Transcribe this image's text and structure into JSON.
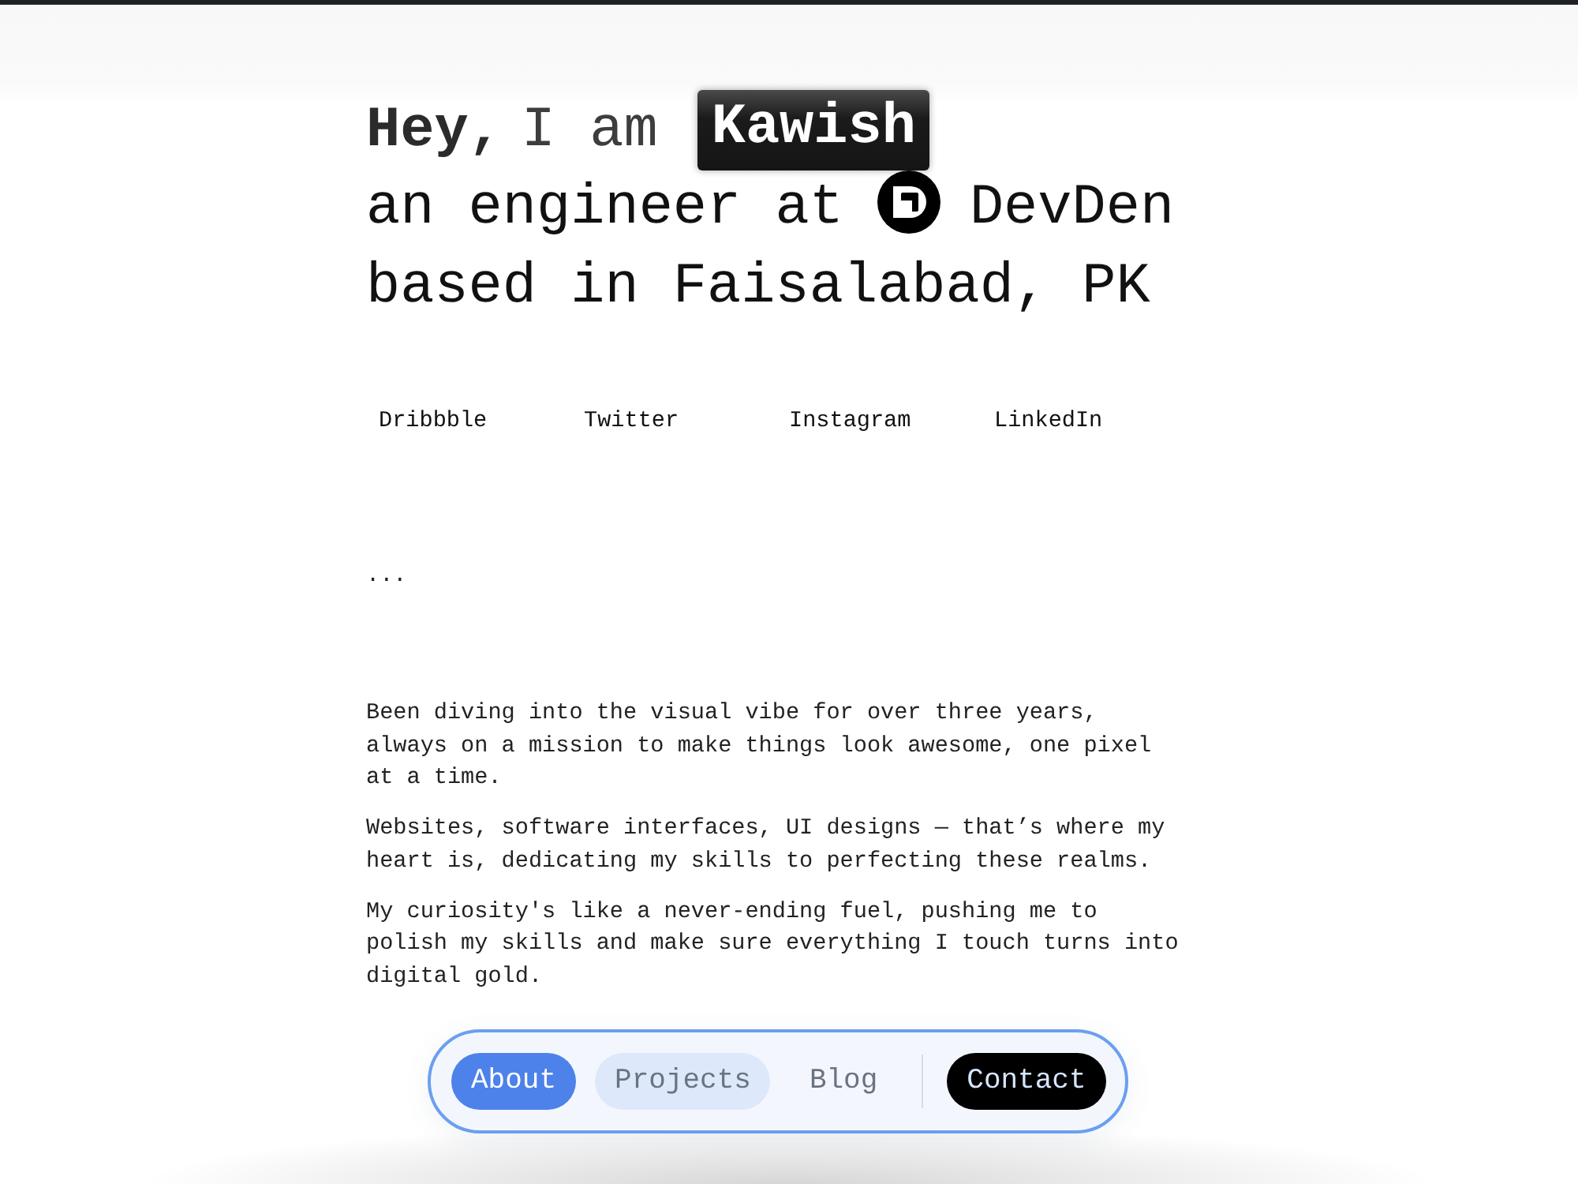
{
  "hero": {
    "greeting": "Hey,",
    "intro": "I am",
    "name": "Kawish",
    "role_line": "an engineer at",
    "company": "DevDen",
    "location_line": "based in Faisalabad, PK"
  },
  "social_links": [
    "Dribbble",
    "Twitter",
    "Instagram",
    "LinkedIn"
  ],
  "ellipsis": "...",
  "about_paragraphs": [
    "Been diving into the visual vibe for over three years, always on a mission to make things look awesome, one pixel at a time.",
    "Websites, software interfaces, UI designs — that’s where my heart is, dedicating my skills to perfecting these realms.",
    "My curiosity's like a never-ending fuel, pushing me to polish my skills and make sure everything I touch turns into digital gold."
  ],
  "nav": {
    "items": [
      {
        "label": "About",
        "selected": true,
        "hovered": false
      },
      {
        "label": "Projects",
        "selected": false,
        "hovered": true
      },
      {
        "label": "Blog",
        "selected": false,
        "hovered": false
      }
    ],
    "contact_button": "Contact"
  }
}
